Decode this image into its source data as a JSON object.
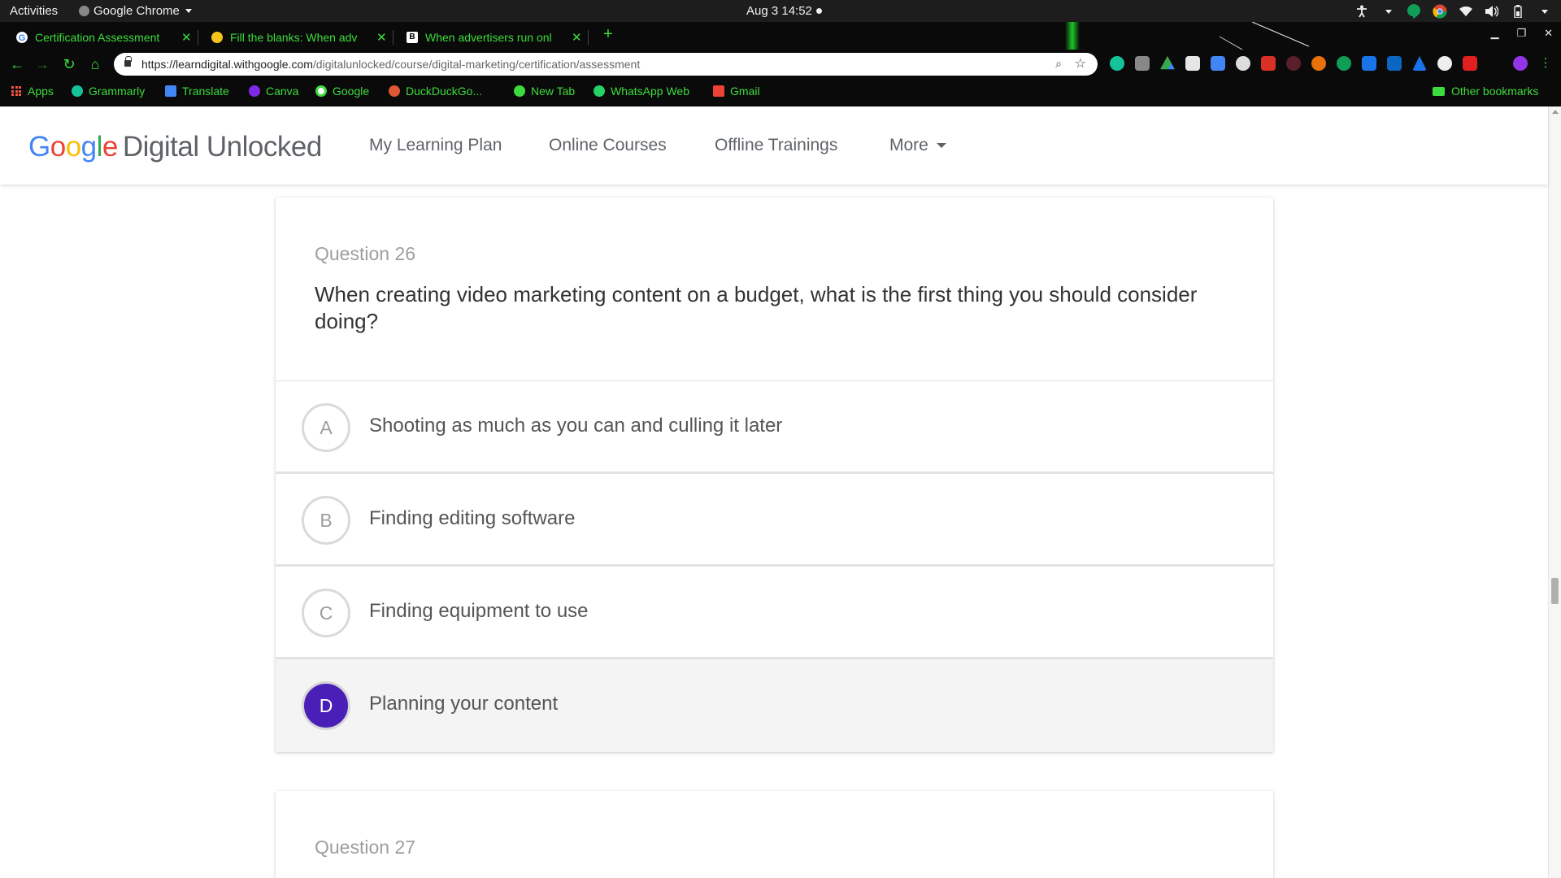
{
  "os": {
    "activities": "Activities",
    "app_name": "Google Chrome",
    "clock": "Aug 3  14:52"
  },
  "browser": {
    "tabs": [
      {
        "title": "Certification Assessment",
        "active": true
      },
      {
        "title": "Fill the blanks: When adv",
        "active": false
      },
      {
        "title": "When advertisers run onl",
        "active": false
      }
    ],
    "url_host": "https://learndigital.withgoogle.com",
    "url_path": "/digitalunlocked/course/digital-marketing/certification/assessment",
    "accent_color": "#3ddc3d",
    "bookmarks": [
      {
        "label": "Apps",
        "icon": "apps-grid-icon"
      },
      {
        "label": "Grammarly",
        "icon": "grammarly-icon"
      },
      {
        "label": "Translate",
        "icon": "translate-icon"
      },
      {
        "label": "Canva",
        "icon": "canva-icon"
      },
      {
        "label": "Google",
        "icon": "google-icon"
      },
      {
        "label": "DuckDuckGo...",
        "icon": "duckduckgo-icon"
      },
      {
        "label": "New Tab",
        "icon": "new-tab-icon"
      },
      {
        "label": "WhatsApp Web",
        "icon": "whatsapp-icon"
      },
      {
        "label": "Gmail",
        "icon": "gmail-icon"
      }
    ],
    "other_bookmarks": "Other bookmarks"
  },
  "site": {
    "logo_google": "Google",
    "logo_rest": "Digital Unlocked",
    "nav": {
      "learning_plan": "My Learning Plan",
      "online_courses": "Online Courses",
      "offline_trainings": "Offline Trainings",
      "more": "More"
    }
  },
  "questions": [
    {
      "number": "Question 26",
      "text": "When creating video marketing content on a budget, what is the first thing you should consider doing?",
      "options": [
        {
          "letter": "A",
          "text": "Shooting as much as you can and culling it later",
          "selected": false
        },
        {
          "letter": "B",
          "text": "Finding editing software",
          "selected": false
        },
        {
          "letter": "C",
          "text": "Finding equipment to use",
          "selected": false
        },
        {
          "letter": "D",
          "text": "Planning your content",
          "selected": true
        }
      ]
    },
    {
      "number": "Question 27"
    }
  ],
  "colors": {
    "selected_option": "#4a1fb8",
    "brand_blue": "#4285f4",
    "brand_red": "#ea4335",
    "brand_yellow": "#fbbc05",
    "brand_green": "#34a853"
  }
}
